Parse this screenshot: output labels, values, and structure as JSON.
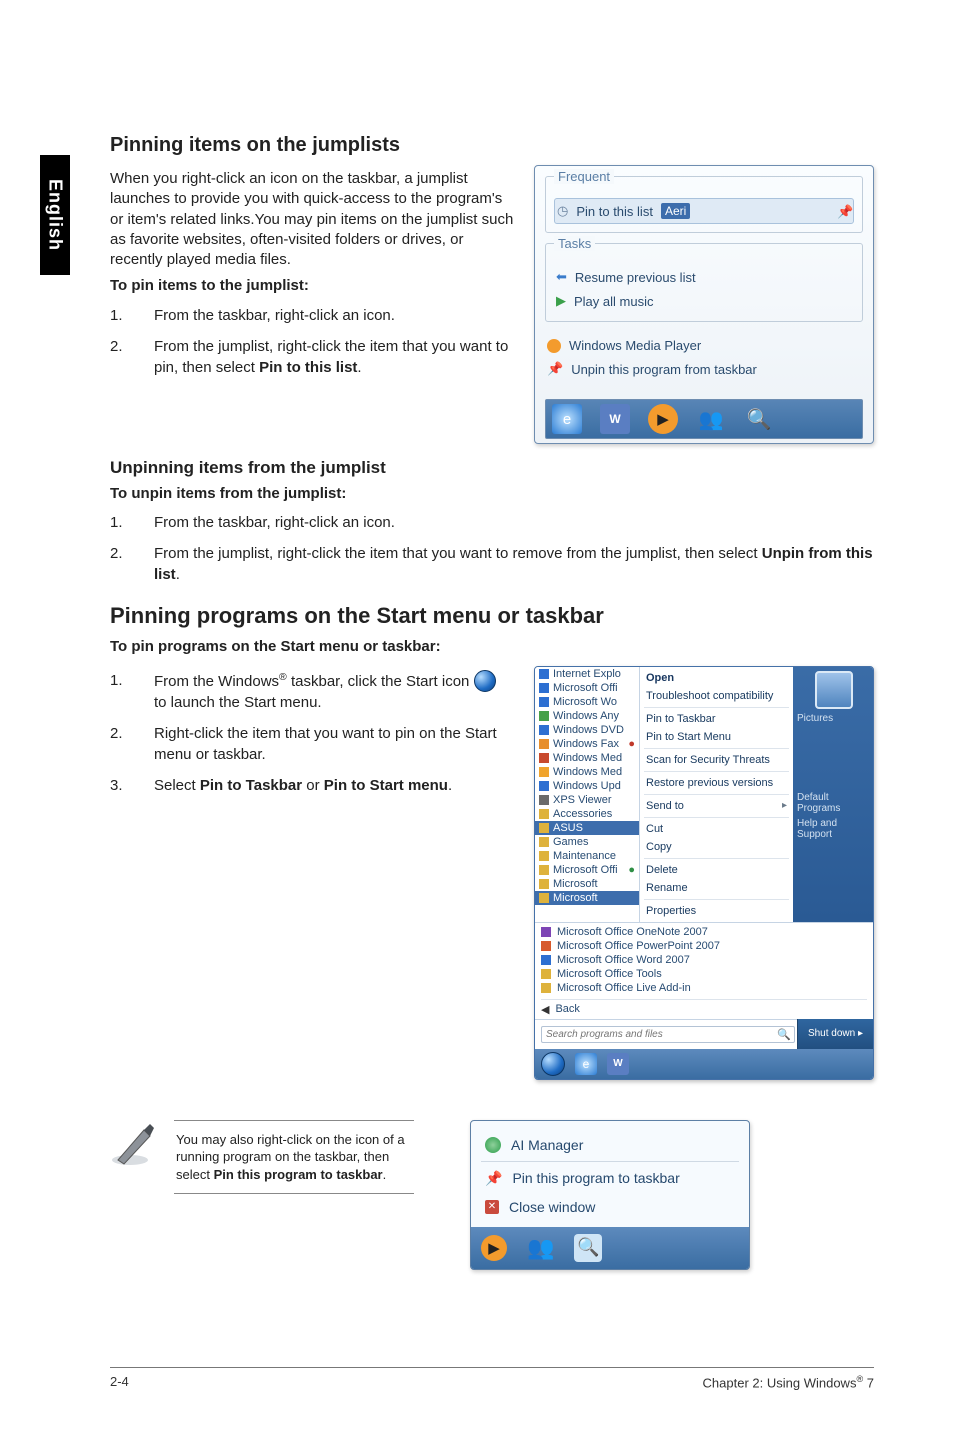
{
  "sidebar_label": "English",
  "h_pin_jumplist": "Pinning items on the jumplists",
  "intro_para": "When you right-click an icon on the taskbar, a jumplist launches to provide you with quick-access to the program's or item's related links.You may pin items on the jumplist such as favorite websites, often-visited folders or drives, or recently played media files.",
  "to_pin_jl": "To pin items to the jumplist:",
  "jl_steps": {
    "s1_num": "1.",
    "s1_text": "From the taskbar, right-click an icon.",
    "s2_num": "2.",
    "s2_text_a": "From the jumplist, right-click the item that you want to pin, then select ",
    "s2_strong": "Pin to this list",
    "s2_text_b": "."
  },
  "h_unpin_jl": "Unpinning items from the jumplist",
  "to_unpin_jl": "To unpin items from the jumplist:",
  "unpin_steps": {
    "s1_num": "1.",
    "s1_text": "From the taskbar, right-click an icon.",
    "s2_num": "2.",
    "s2_text_a": "From the jumplist, right-click the item that you want to remove from the jumplist, then select ",
    "s2_strong": "Unpin from this list",
    "s2_text_b": "."
  },
  "h_pin_programs": "Pinning programs on the Start menu or taskbar",
  "to_pin_prog": "To pin programs on the Start menu or taskbar:",
  "prog_steps": {
    "s1_num": "1.",
    "s1_a": "From the Windows",
    "s1_reg": "®",
    "s1_b": " taskbar, click the Start icon ",
    "s1_c": " to launch the Start menu.",
    "s2_num": "2.",
    "s2_text": "Right-click the item that you want to pin on the Start menu or taskbar.",
    "s3_num": "3.",
    "s3_a": "Select ",
    "s3_strong1": "Pin to Taskbar",
    "s3_b": " or ",
    "s3_strong2": "Pin to Start menu",
    "s3_c": "."
  },
  "note": {
    "a": "You may also right-click on the icon of a running program on the taskbar, then select ",
    "strong": "Pin this program to taskbar",
    "b": "."
  },
  "footer_left": "2-4",
  "footer_right_a": "Chapter 2: Using Windows",
  "footer_reg": "®",
  "footer_right_b": " 7",
  "shot1": {
    "frequent": "Frequent",
    "pinned_item": "Pin to this list",
    "pinned_badge": "Aeri",
    "tasks": "Tasks",
    "resume": "Resume previous list",
    "play_all": "Play all music",
    "wmp": "Windows Media Player",
    "unpin": "Unpin this program from taskbar"
  },
  "shot2": {
    "left_items": [
      "Internet Explo",
      "Microsoft Offi",
      "Microsoft Wo",
      "Windows Any",
      "Windows DVD",
      "Windows Fax",
      "Windows Med",
      "Windows Med",
      "Windows Upd",
      "XPS Viewer",
      "Accessories",
      "ASUS",
      "Games",
      "Maintenance",
      "Microsoft Offi",
      "Microsoft",
      "Microsoft"
    ],
    "menu": {
      "open": "Open",
      "trouble": "Troubleshoot compatibility",
      "pin_tb": "Pin to Taskbar",
      "pin_sm": "Pin to Start Menu",
      "scan": "Scan for Security Threats",
      "restore": "Restore previous versions",
      "send": "Send to",
      "cut": "Cut",
      "copy": "Copy",
      "delete": "Delete",
      "rename": "Rename",
      "props": "Properties"
    },
    "right": {
      "pictures": "Pictures",
      "default": "Default Programs",
      "help": "Help and Support"
    },
    "recent": [
      "Microsoft Office OneNote 2007",
      "Microsoft Office PowerPoint 2007",
      "Microsoft Office Word 2007",
      "Microsoft Office Tools",
      "Microsoft Office Live Add-in"
    ],
    "back": "Back",
    "search_ph": "Search programs and files",
    "shutdown": "Shut down"
  },
  "shot3": {
    "ai_manager": "AI Manager",
    "pin_prog": "Pin this program to taskbar",
    "close": "Close window"
  }
}
